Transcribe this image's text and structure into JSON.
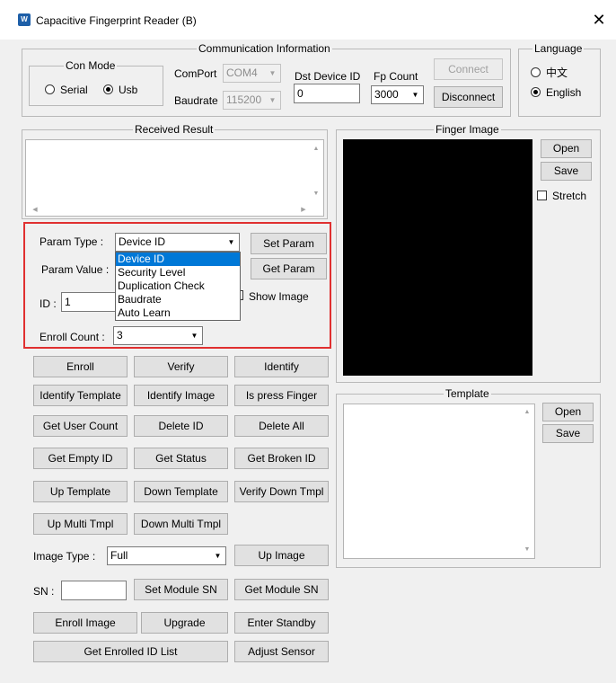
{
  "window": {
    "title": "Capacitive Fingerprint Reader (B)",
    "close_glyph": "✕",
    "icon_text": "W"
  },
  "communication": {
    "group_label": "Communication Information",
    "con_mode": {
      "label": "Con Mode",
      "serial": "Serial",
      "usb": "Usb",
      "selected": "Usb"
    },
    "comport_label": "ComPort",
    "comport_value": "COM4",
    "baudrate_label": "Baudrate",
    "baudrate_value": "115200",
    "dst_device_label": "Dst Device ID",
    "dst_device_value": "0",
    "fp_count_label": "Fp Count",
    "fp_count_value": "3000",
    "connect": "Connect",
    "disconnect": "Disconnect"
  },
  "language": {
    "label": "Language",
    "chinese": "中文",
    "english": "English",
    "selected": "English"
  },
  "received": {
    "label": "Received Result"
  },
  "params": {
    "param_type_label": "Param Type :",
    "param_type_value": "Device ID",
    "param_value_label": "Param Value :",
    "id_label": "ID :",
    "id_value": "1",
    "show_image": "Show Image",
    "enroll_count_label": "Enroll Count :",
    "enroll_count_value": "3",
    "set_param": "Set Param",
    "get_param": "Get Param",
    "dropdown_options": [
      "Device ID",
      "Security Level",
      "Duplication Check",
      "Baudrate",
      "Auto Learn"
    ]
  },
  "buttons": {
    "enroll": "Enroll",
    "verify": "Verify",
    "identify": "Identify",
    "identify_template": "Identify Template",
    "identify_image": "Identify Image",
    "is_press_finger": "Is press Finger",
    "get_user_count": "Get User Count",
    "delete_id": "Delete ID",
    "delete_all": "Delete All",
    "get_empty_id": "Get Empty ID",
    "get_status": "Get Status",
    "get_broken_id": "Get Broken ID",
    "up_template": "Up Template",
    "down_template": "Down Template",
    "verify_down_tmpl": "Verify Down Tmpl",
    "up_multi_tmpl": "Up Multi Tmpl",
    "down_multi_tmpl": "Down Multi Tmpl",
    "up_image": "Up Image",
    "set_module_sn": "Set Module SN",
    "get_module_sn": "Get Module SN",
    "enroll_image": "Enroll Image",
    "upgrade": "Upgrade",
    "enter_standby": "Enter Standby",
    "get_enrolled_id_list": "Get Enrolled ID List",
    "adjust_sensor": "Adjust Sensor"
  },
  "image_type": {
    "label": "Image Type :",
    "value": "Full"
  },
  "sn": {
    "label": "SN :",
    "value": ""
  },
  "finger_image": {
    "label": "Finger Image",
    "open": "Open",
    "save": "Save",
    "stretch": "Stretch"
  },
  "template": {
    "label": "Template",
    "open": "Open",
    "save": "Save"
  },
  "colors": {
    "highlight_border": "#e03030",
    "selection": "#0078d7",
    "image_bg": "#000000"
  }
}
